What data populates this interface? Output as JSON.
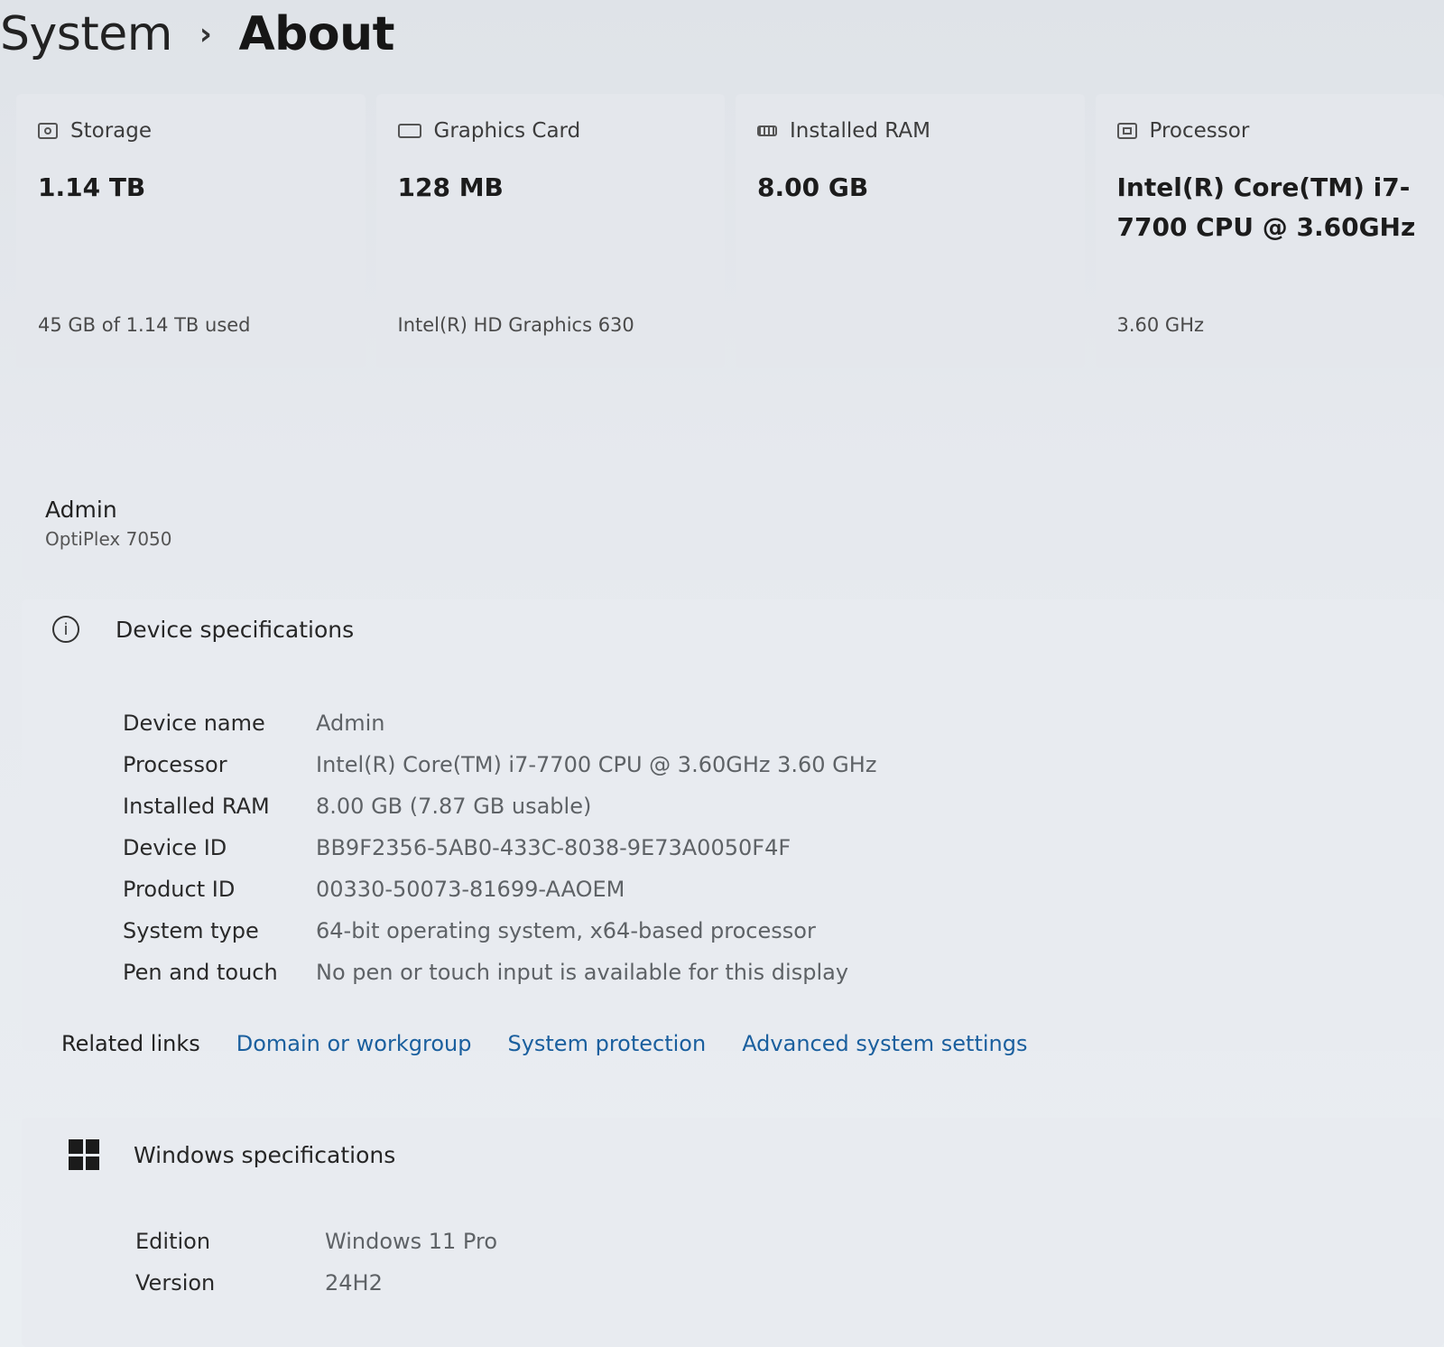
{
  "breadcrumb": {
    "parent": "System",
    "separator": "›",
    "current": "About"
  },
  "cards": [
    {
      "icon": "storage-icon",
      "title": "Storage",
      "value": "1.14 TB",
      "sub": "45 GB of 1.14 TB used"
    },
    {
      "icon": "graphics-card-icon",
      "title": "Graphics Card",
      "value": "128 MB",
      "sub": "Intel(R) HD Graphics 630"
    },
    {
      "icon": "ram-icon",
      "title": "Installed RAM",
      "value": "8.00 GB",
      "sub": ""
    },
    {
      "icon": "processor-icon",
      "title": "Processor",
      "value": "Intel(R) Core(TM) i7-7700 CPU @ 3.60GHz",
      "sub": "3.60 GHz"
    }
  ],
  "device": {
    "name": "Admin",
    "model": "OptiPlex 7050"
  },
  "device_specs": {
    "title": "Device specifications",
    "icon": "info-icon",
    "rows": [
      {
        "label": "Device name",
        "value": "Admin"
      },
      {
        "label": "Processor",
        "value": "Intel(R) Core(TM) i7-7700 CPU @ 3.60GHz   3.60 GHz"
      },
      {
        "label": "Installed RAM",
        "value": "8.00 GB (7.87 GB usable)"
      },
      {
        "label": "Device ID",
        "value": "BB9F2356-5AB0-433C-8038-9E73A0050F4F"
      },
      {
        "label": "Product ID",
        "value": "00330-50073-81699-AAOEM"
      },
      {
        "label": "System type",
        "value": "64-bit operating system, x64-based processor"
      },
      {
        "label": "Pen and touch",
        "value": "No pen or touch input is available for this display"
      }
    ]
  },
  "related_links": {
    "title": "Related links",
    "links": [
      "Domain or workgroup",
      "System protection",
      "Advanced system settings"
    ],
    "link_color": "#1a5f9e"
  },
  "windows_specs": {
    "title": "Windows specifications",
    "icon": "windows-logo-icon",
    "rows": [
      {
        "label": "Edition",
        "value": "Windows 11 Pro"
      },
      {
        "label": "Version",
        "value": "24H2"
      }
    ]
  }
}
